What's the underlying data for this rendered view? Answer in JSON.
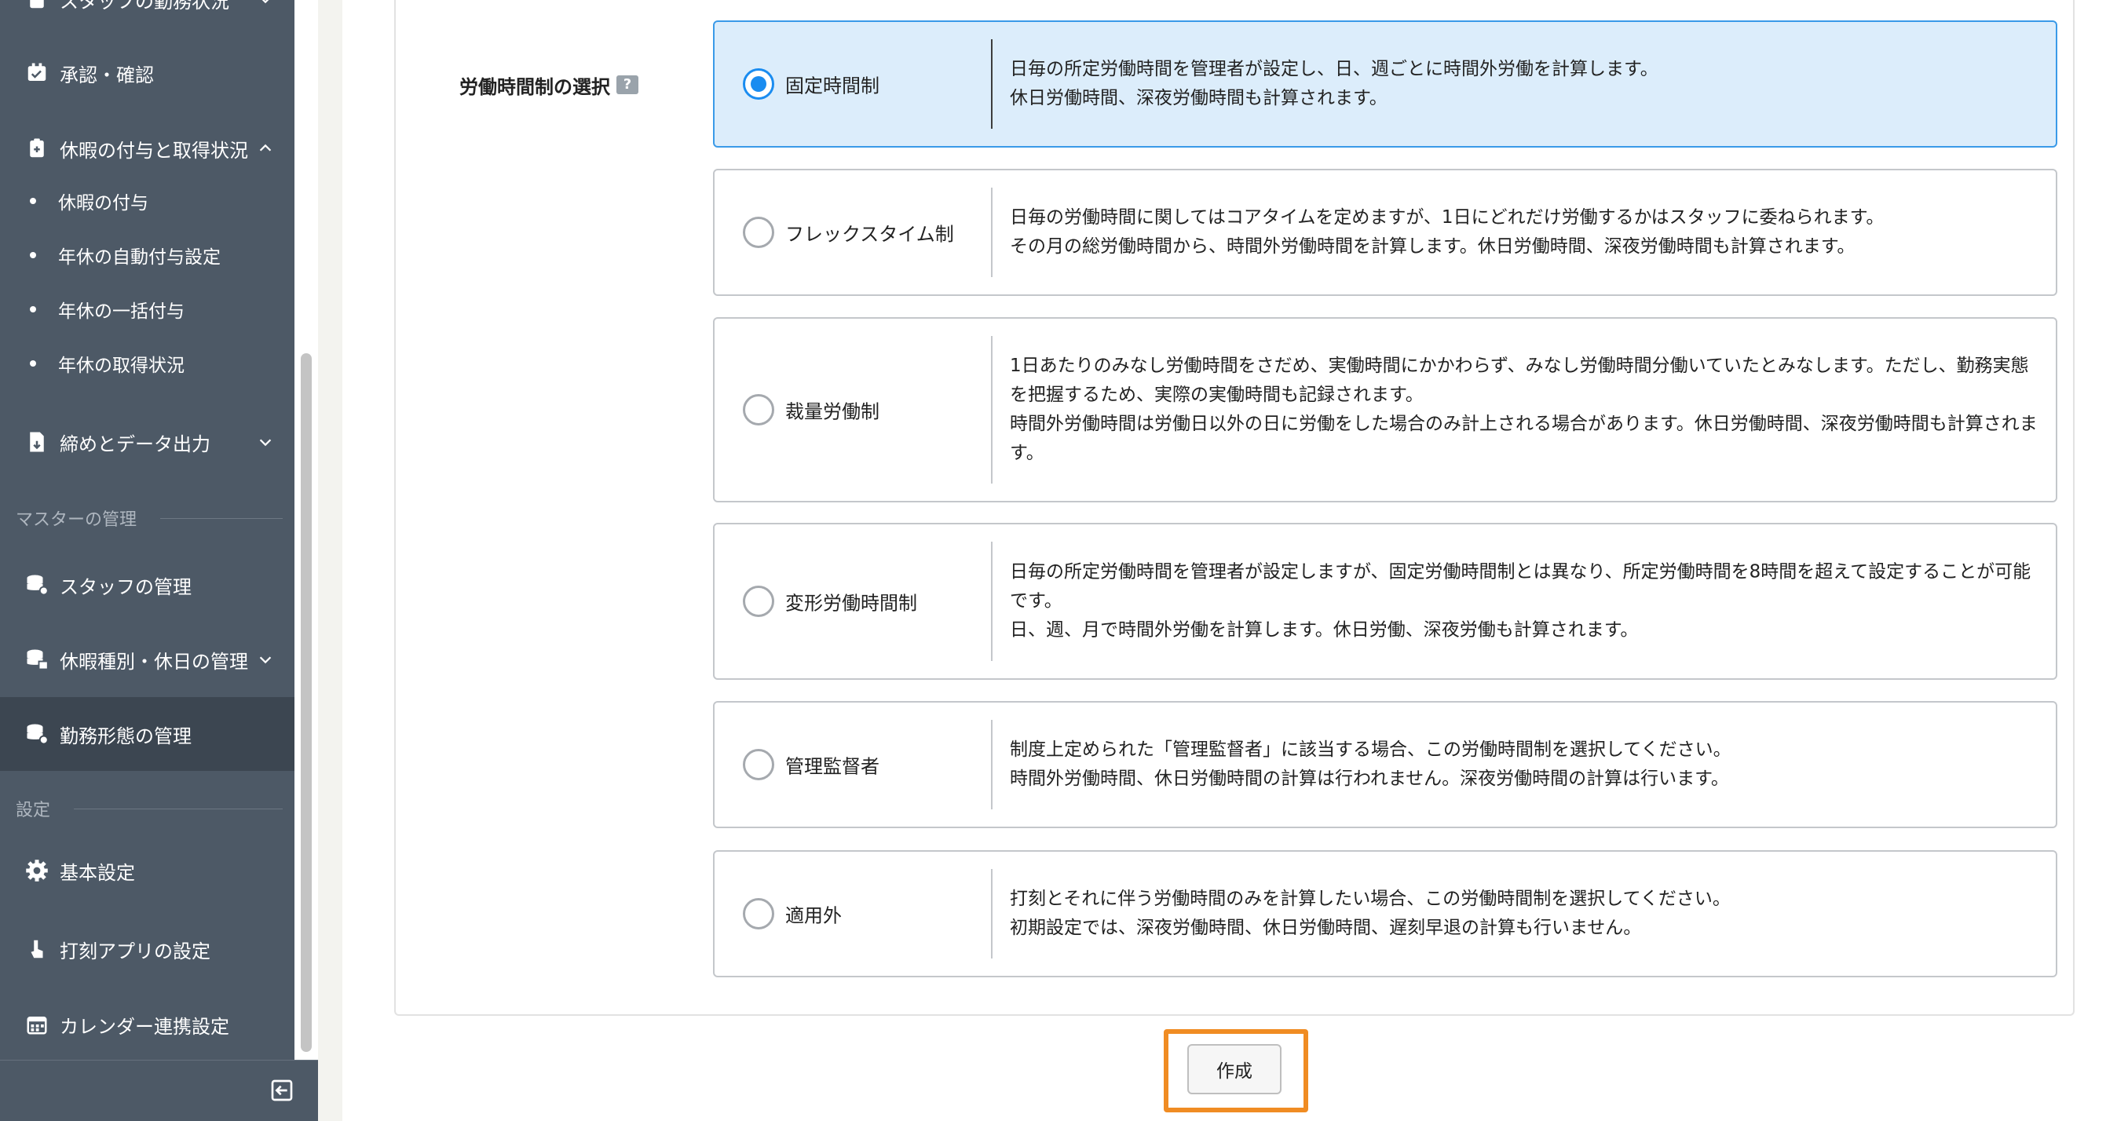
{
  "sidebar": {
    "top_item": {
      "label": "スタッフの勤務状況"
    },
    "items": [
      {
        "label": "承認・確認"
      },
      {
        "label": "休暇の付与と取得状況"
      },
      {
        "label": "締めとデータ出力"
      },
      {
        "label": "スタッフの管理"
      },
      {
        "label": "休暇種別・休日の管理"
      },
      {
        "label": "勤務形態の管理"
      },
      {
        "label": "基本設定"
      },
      {
        "label": "打刻アプリの設定"
      },
      {
        "label": "カレンダー連携設定"
      }
    ],
    "sub_items": [
      {
        "label": "休暇の付与"
      },
      {
        "label": "年休の自動付与設定"
      },
      {
        "label": "年休の一括付与"
      },
      {
        "label": "年休の取得状況"
      }
    ],
    "sections": {
      "master": "マスターの管理",
      "settings": "設定"
    }
  },
  "form": {
    "field_label": "労働時間制の選択",
    "help_icon_text": "?",
    "options": [
      {
        "label": "固定時間制",
        "selected": true,
        "desc": [
          "日毎の所定労働時間を管理者が設定し、日、週ごとに時間外労働を計算します。",
          "休日労働時間、深夜労働時間も計算されます。"
        ]
      },
      {
        "label": "フレックスタイム制",
        "selected": false,
        "desc": [
          "日毎の労働時間に関してはコアタイムを定めますが、1日にどれだけ労働するかはスタッフに委ねられます。",
          "その月の総労働時間から、時間外労働時間を計算します。休日労働時間、深夜労働時間も計算されます。"
        ]
      },
      {
        "label": "裁量労働制",
        "selected": false,
        "desc": [
          "1日あたりのみなし労働時間をさだめ、実働時間にかかわらず、みなし労働時間分働いていたとみなします。ただし、勤務実態を把握するため、実際の実働時間も記録されます。",
          "時間外労働時間は労働日以外の日に労働をした場合のみ計上される場合があります。休日労働時間、深夜労働時間も計算されます。"
        ]
      },
      {
        "label": "変形労働時間制",
        "selected": false,
        "desc": [
          "日毎の所定労働時間を管理者が設定しますが、固定労働時間制とは異なり、所定労働時間を8時間を超えて設定することが可能です。",
          "日、週、月で時間外労働を計算します。休日労働、深夜労働も計算されます。"
        ]
      },
      {
        "label": "管理監督者",
        "selected": false,
        "desc": [
          "制度上定められた「管理監督者」に該当する場合、この労働時間制を選択してください。",
          "時間外労働時間、休日労働時間の計算は行われません。深夜労働時間の計算は行います。"
        ]
      },
      {
        "label": "適用外",
        "selected": false,
        "desc": [
          "打刻とそれに伴う労働時間のみを計算したい場合、この労働時間制を選択してください。",
          "初期設定では、深夜労働時間、休日労働時間、遅刻早退の計算も行いません。"
        ]
      }
    ]
  },
  "actions": {
    "create_label": "作成"
  },
  "colors": {
    "sidebar_bg": "#4d5966",
    "selected_bg": "#dcedfb",
    "radio_accent": "#1a8cf0",
    "highlight": "#f08c23"
  }
}
